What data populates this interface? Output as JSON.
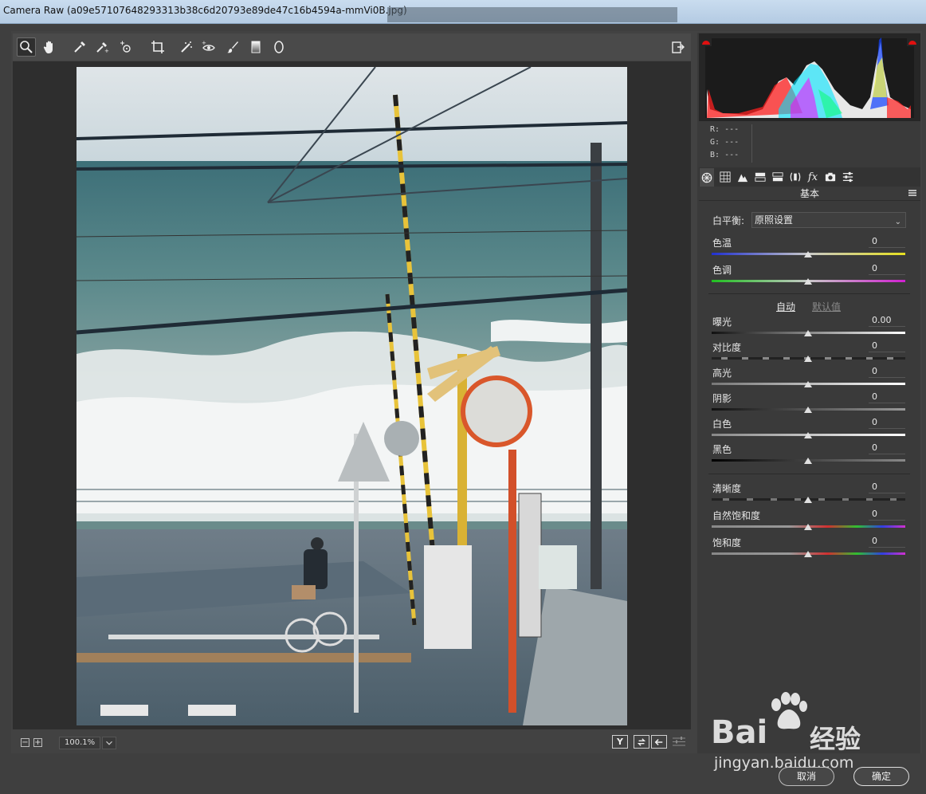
{
  "window": {
    "title": "Camera Raw (a09e57107648293313b38c6d20793e89de47c16b4594a-mmVi0B.jpg)"
  },
  "toolbar": {
    "tools": [
      "zoom-icon",
      "hand-icon",
      "white-balance-icon",
      "color-sampler-icon",
      "targeted-adjustment-icon",
      "crop-icon",
      "spot-removal-icon",
      "red-eye-icon",
      "adjustment-brush-icon",
      "graduated-filter-icon",
      "radial-filter-icon"
    ],
    "active_tool": "zoom-icon"
  },
  "zoom": {
    "value": "100.1%"
  },
  "view_buttons": {
    "compare": "Y"
  },
  "histogram": {
    "r_label": "R:",
    "g_label": "G:",
    "b_label": "B:",
    "r_value": "---",
    "g_value": "---",
    "b_value": "---"
  },
  "panel": {
    "title": "基本",
    "white_balance": {
      "label": "白平衡:",
      "value": "原照设置"
    },
    "sliders_wb": [
      {
        "label": "色温",
        "value": "0"
      },
      {
        "label": "色调",
        "value": "0"
      }
    ],
    "auto_label": "自动",
    "default_label": "默认值",
    "sliders_tone": [
      {
        "label": "曝光",
        "value": "0.00"
      },
      {
        "label": "对比度",
        "value": "0"
      },
      {
        "label": "高光",
        "value": "0"
      },
      {
        "label": "阴影",
        "value": "0"
      },
      {
        "label": "白色",
        "value": "0"
      },
      {
        "label": "黑色",
        "value": "0"
      }
    ],
    "sliders_presence": [
      {
        "label": "清晰度",
        "value": "0"
      },
      {
        "label": "自然饱和度",
        "value": "0"
      },
      {
        "label": "饱和度",
        "value": "0"
      }
    ]
  },
  "buttons": {
    "cancel": "取消",
    "ok": "确定"
  },
  "watermark": {
    "brand": "Bai",
    "brand2": "经验",
    "url": "jingyan.baidu.com"
  },
  "colors": {
    "panel_bg": "#3a3a3a",
    "preview_bg": "#2e2e2e",
    "clip_warning": "#e01010"
  }
}
